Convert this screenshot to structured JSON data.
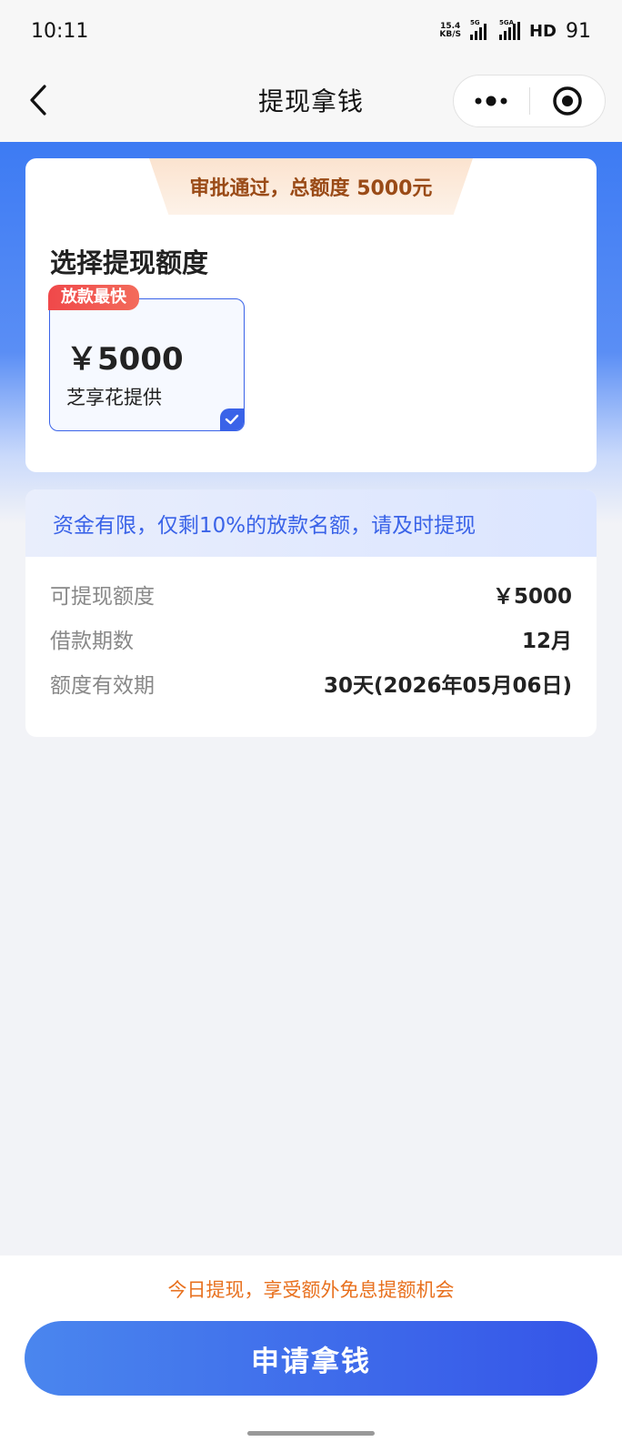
{
  "status_bar": {
    "time": "10:11",
    "net_speed_top": "15.4",
    "net_speed_bottom": "KB/S",
    "sim1_label": "5G",
    "sim2_label": "5GA",
    "hd_label": "HD",
    "battery": "91"
  },
  "nav": {
    "title": "提现拿钱",
    "back_icon": "chevron-left-icon",
    "more_icon": "more-dots-icon",
    "close_icon": "target-circle-icon"
  },
  "approval": {
    "banner": "审批通过，总额度 5000元"
  },
  "select": {
    "title": "选择提现额度",
    "options": [
      {
        "badge": "放款最快",
        "amount": "￥5000",
        "provider": "芝享花提供",
        "selected": true
      }
    ]
  },
  "info": {
    "notice": "资金有限，仅剩10%的放款名额，请及时提现",
    "rows": [
      {
        "label": "可提现额度",
        "value": "￥5000"
      },
      {
        "label": "借款期数",
        "value": "12月"
      },
      {
        "label": "额度有效期",
        "value": "30天(2026年05月06日)"
      }
    ]
  },
  "footer": {
    "promo": "今日提现，享受额外免息提额机会",
    "apply_label": "申请拿钱"
  },
  "colors": {
    "brand_blue": "#3a63e8",
    "badge_red": "#f0484a",
    "promo_orange": "#e8711f",
    "ribbon_text": "#9a4b17"
  }
}
